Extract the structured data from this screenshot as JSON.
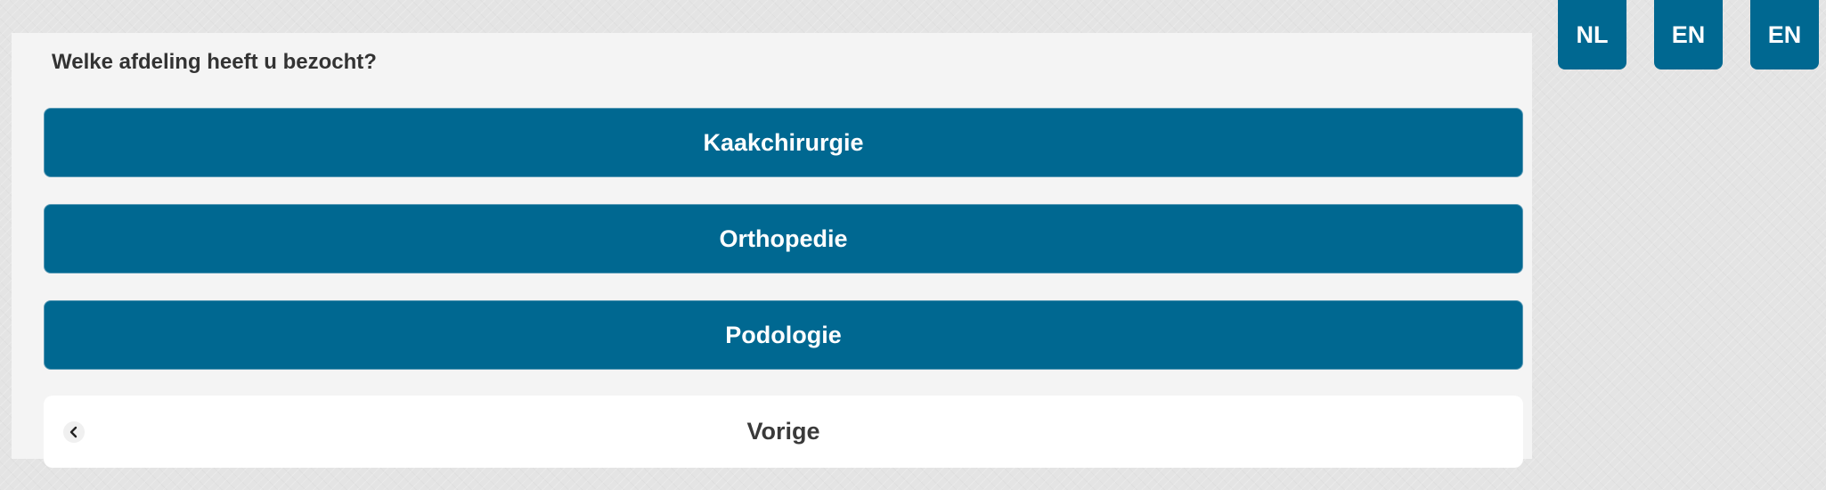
{
  "survey": {
    "question": "Welke afdeling heeft u bezocht?",
    "options": [
      {
        "label": "Kaakchirurgie"
      },
      {
        "label": "Orthopedie"
      },
      {
        "label": "Podologie"
      }
    ],
    "back": {
      "label": "Vorige",
      "icon": "chevron-left-icon"
    }
  },
  "languages": [
    {
      "label": "NL"
    },
    {
      "label": "EN"
    },
    {
      "label": "EN"
    }
  ],
  "colors": {
    "primary": "#006891",
    "panel_background": "#f4f4f4",
    "page_background": "#e4e4e4",
    "question_text": "#333333",
    "back_text": "#3a3a3a"
  }
}
